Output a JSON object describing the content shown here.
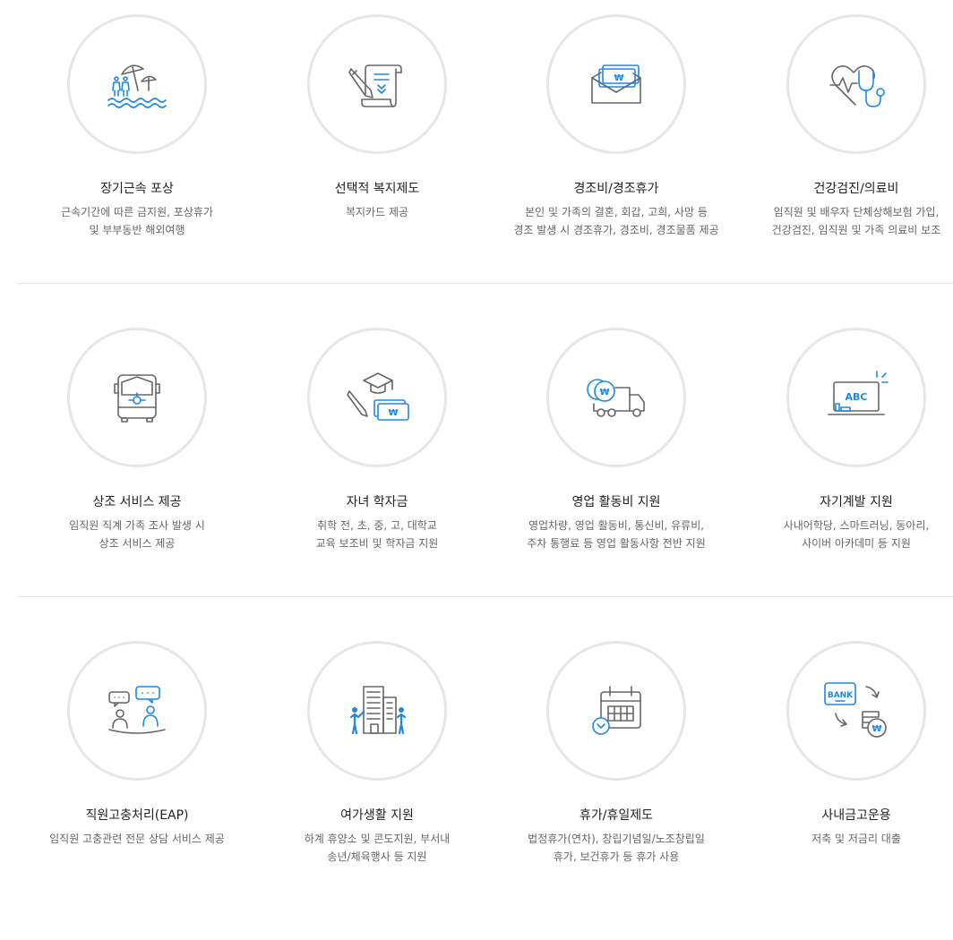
{
  "colors": {
    "accent": "#1e88e5",
    "icon_gray": "#666666",
    "circle_border": "#e6e6e6",
    "divider": "#e5e5e5"
  },
  "rows": [
    {
      "items": [
        {
          "icon": "beach-umbrella-icon",
          "title": "장기근속 포상",
          "desc": [
            "근속기간에 따른 금지원, 포상휴가",
            "및 부부동반 해외여행"
          ]
        },
        {
          "icon": "document-pen-icon",
          "title": "선택적 복지제도",
          "desc": [
            "복지카드 제공"
          ]
        },
        {
          "icon": "money-envelope-icon",
          "title": "경조비/경조휴가",
          "desc": [
            "본인 및 가족의 결혼, 회갑, 고희, 사망 등",
            "경조 발생 시 경조휴가, 경조비, 경조물품 제공"
          ]
        },
        {
          "icon": "heart-stethoscope-icon",
          "title": "건강검진/의료비",
          "desc": [
            "임직원 및 배우자 단체상해보험 가입,",
            "건강검진, 임직원 및 가족 의료비 보조"
          ]
        }
      ]
    },
    {
      "items": [
        {
          "icon": "funeral-bus-icon",
          "title": "상조 서비스 제공",
          "desc": [
            "임직원 직계 가족 조사 발생 시",
            "상조 서비스 제공"
          ]
        },
        {
          "icon": "graduation-money-icon",
          "title": "자녀 학자금",
          "desc": [
            "취학 전, 초, 중, 고, 대학교",
            "교육 보조비 및 학자금 지원"
          ]
        },
        {
          "icon": "coin-truck-icon",
          "title": "영업 활동비 지원",
          "desc": [
            "영업차량, 영업 활동비, 통신비, 유류비,",
            "주차 통행료 등 영업 활동사항 전반 지원"
          ]
        },
        {
          "icon": "abc-laptop-icon",
          "title": "자기계발 지원",
          "desc": [
            "사내어학당, 스마트러닝, 동아리,",
            "사이버 아카데미 등 지원"
          ]
        }
      ]
    },
    {
      "items": [
        {
          "icon": "counseling-chat-icon",
          "title": "직원고충처리(EAP)",
          "desc": [
            "임직원 고충관련 전문 상담 서비스 제공"
          ]
        },
        {
          "icon": "building-people-icon",
          "title": "여가생활 지원",
          "desc": [
            "하계 휴양소 및 콘도지원, 부서내",
            "송년/체육행사 등 지원"
          ]
        },
        {
          "icon": "calendar-clock-icon",
          "title": "휴가/휴일제도",
          "desc": [
            "법정휴가(연차), 창립기념일/노조창립일",
            "휴가, 보건휴가 등 휴가 사용"
          ]
        },
        {
          "icon": "bank-coins-icon",
          "title": "사내금고운용",
          "desc": [
            "저축 및 저금리 대출"
          ]
        }
      ]
    }
  ],
  "icon_text": {
    "money": "₩",
    "abc": "ABC",
    "bank": "BANK"
  }
}
